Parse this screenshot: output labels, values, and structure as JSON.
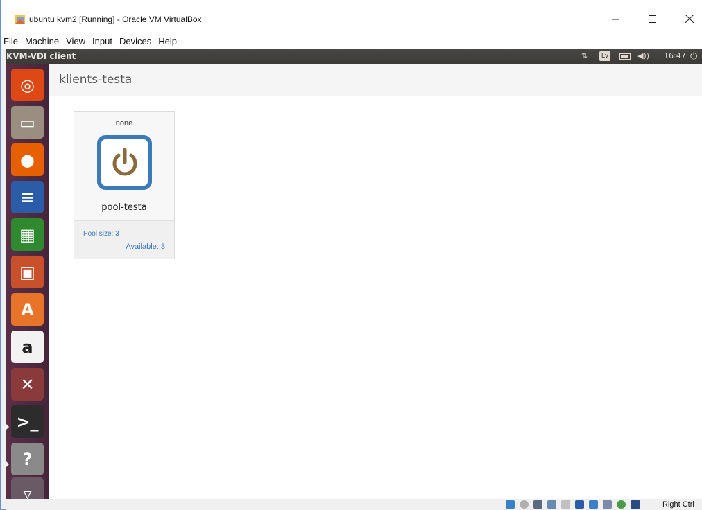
{
  "window": {
    "title": "ubuntu kvm2 [Running] - Oracle VM VirtualBox",
    "min_glyph": "—",
    "max_glyph": "☐",
    "close_glyph": "✕"
  },
  "menu": [
    "File",
    "Machine",
    "View",
    "Input",
    "Devices",
    "Help"
  ],
  "panel": {
    "app_title": "KVM-VDI client",
    "keyboard_layout": "Lv",
    "volume_glyph": "◀))",
    "network_glyph": "⇅",
    "clock": "16:47",
    "power_glyph": "⏻"
  },
  "launcher": [
    {
      "name": "dash-home",
      "color": "#dd4814",
      "glyph": "◎"
    },
    {
      "name": "files",
      "color": "#9a8e80",
      "glyph": "▭"
    },
    {
      "name": "firefox",
      "color": "#e66000",
      "glyph": "●"
    },
    {
      "name": "writer",
      "color": "#2a5ca8",
      "glyph": "≡"
    },
    {
      "name": "calc",
      "color": "#2f8a2f",
      "glyph": "▦"
    },
    {
      "name": "impress",
      "color": "#c8502a",
      "glyph": "▣"
    },
    {
      "name": "software-center",
      "color": "#e8742a",
      "glyph": "A"
    },
    {
      "name": "amazon",
      "color": "#f2f2f2",
      "glyph": "a"
    },
    {
      "name": "system-settings",
      "color": "#8a3a3a",
      "glyph": "✕"
    },
    {
      "name": "terminal",
      "color": "#2c2c2c",
      "glyph": ">_"
    },
    {
      "name": "help",
      "color": "#8a8a8a",
      "glyph": "?"
    },
    {
      "name": "trash",
      "color": "#6a5a66",
      "glyph": "▿"
    }
  ],
  "app": {
    "header_title": "klients-testa",
    "pool": {
      "state": "none",
      "name": "pool-testa",
      "pool_size": "Pool size: 3",
      "available": "Available: 3",
      "accent": "#3c7bb8",
      "power_color": "#8a6a3a"
    }
  },
  "statusbar": {
    "host_key": "Right Ctrl"
  }
}
